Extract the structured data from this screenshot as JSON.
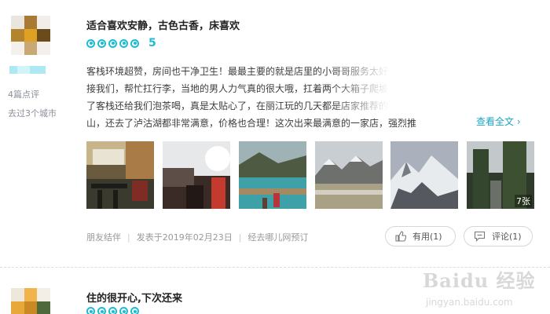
{
  "review1": {
    "user": {
      "reviews_count": "4篇点评",
      "cities_count": "去过3个城市"
    },
    "title": "适合喜欢安静，古色古香，床喜欢",
    "rating": {
      "score": "5",
      "dots": 5
    },
    "body_lines": [
      "客栈环境超赞，房间也干净卫生！最最主要的就是店里的小哥哥服务太好了，刚到就来路边",
      "接我们，帮忙扛行李，当地的男人力气真的很大哦，扛着两个大箱子爬坡一点都不喘气，到",
      "了客栈还给我们泡茶喝，真是太贴心了，在丽江玩的几天都是店家推荐的小团，去了玉龙雪",
      "山，还去了泸沽湖都非常满意，价格也合理！这次出来最满意的一家店，强烈推"
    ],
    "read_more": "查看全文",
    "photo_count": "7张",
    "footer": {
      "trip_type": "朋友结伴",
      "published": "发表于2019年02月23日",
      "booked_via": "经去哪儿网预订"
    },
    "like_label": "有用(1)",
    "comment_label": "评论(1)"
  },
  "review2": {
    "title": "住的很开心,下次还来"
  },
  "watermark": {
    "brand": "Baidu 经验",
    "site": "jingyan.baidu.com"
  },
  "colors": {
    "accent": "#1ebcd4",
    "link": "#1aa5c2",
    "muted": "#999999"
  }
}
